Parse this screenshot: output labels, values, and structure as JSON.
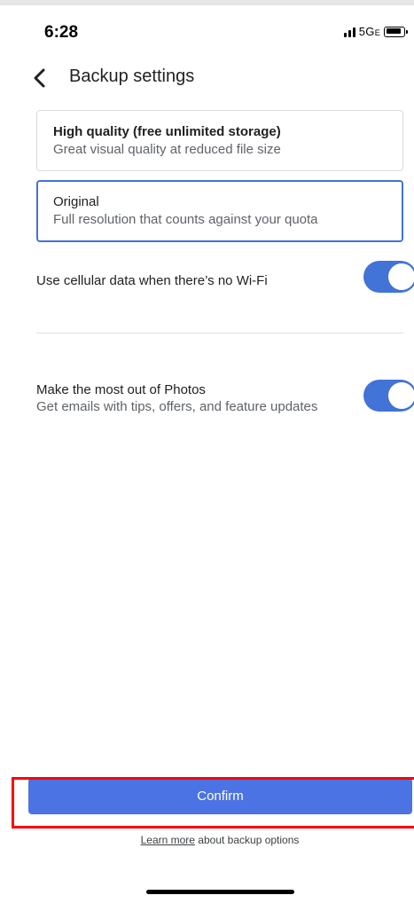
{
  "status_bar": {
    "time": "6:28",
    "network": "5G",
    "network_suffix": "E",
    "icons": [
      "signal-icon",
      "battery-icon"
    ]
  },
  "header": {
    "back_icon": "chevron-left-icon",
    "title": "Backup settings"
  },
  "options": [
    {
      "title": "High quality (free unlimited storage)",
      "subtitle": "Great visual quality at reduced file size",
      "selected": false
    },
    {
      "title": "Original",
      "subtitle": "Full resolution that counts against your quota",
      "selected": true
    }
  ],
  "settings": {
    "cellular": {
      "label": "Use cellular data when there’s no Wi-Fi",
      "enabled": true
    },
    "photos": {
      "title": "Make the most out of Photos",
      "subtitle": "Get emails with tips, offers, and feature updates",
      "enabled": true
    }
  },
  "footer": {
    "confirm_label": "Confirm",
    "learn_link": "Learn more",
    "learn_rest": " about backup options"
  },
  "colors": {
    "accent": "#4273d6",
    "confirm": "#4b73e3",
    "highlight": "#ff0000"
  }
}
